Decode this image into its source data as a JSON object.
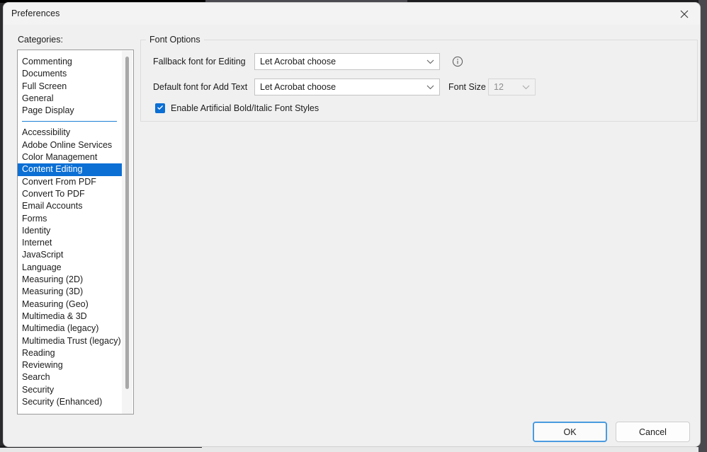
{
  "window": {
    "title": "Preferences",
    "close_icon": "close-icon"
  },
  "sidebar": {
    "label": "Categories:",
    "group_one": [
      {
        "label": "Commenting"
      },
      {
        "label": "Documents"
      },
      {
        "label": "Full Screen"
      },
      {
        "label": "General"
      },
      {
        "label": "Page Display"
      }
    ],
    "group_two": [
      {
        "label": "Accessibility",
        "selected": false
      },
      {
        "label": "Adobe Online Services",
        "selected": false
      },
      {
        "label": "Color Management",
        "selected": false
      },
      {
        "label": "Content Editing",
        "selected": true
      },
      {
        "label": "Convert From PDF",
        "selected": false
      },
      {
        "label": "Convert To PDF",
        "selected": false
      },
      {
        "label": "Email Accounts",
        "selected": false
      },
      {
        "label": "Forms",
        "selected": false
      },
      {
        "label": "Identity",
        "selected": false
      },
      {
        "label": "Internet",
        "selected": false
      },
      {
        "label": "JavaScript",
        "selected": false
      },
      {
        "label": "Language",
        "selected": false
      },
      {
        "label": "Measuring (2D)",
        "selected": false
      },
      {
        "label": "Measuring (3D)",
        "selected": false
      },
      {
        "label": "Measuring (Geo)",
        "selected": false
      },
      {
        "label": "Multimedia & 3D",
        "selected": false
      },
      {
        "label": "Multimedia (legacy)",
        "selected": false
      },
      {
        "label": "Multimedia Trust (legacy)",
        "selected": false
      },
      {
        "label": "Reading",
        "selected": false
      },
      {
        "label": "Reviewing",
        "selected": false
      },
      {
        "label": "Search",
        "selected": false
      },
      {
        "label": "Security",
        "selected": false
      },
      {
        "label": "Security (Enhanced)",
        "selected": false
      }
    ],
    "selected_category": "Content Editing"
  },
  "panel": {
    "group_title": "Font Options",
    "fallback_font": {
      "label": "Fallback font for Editing",
      "value": "Let Acrobat choose"
    },
    "default_font": {
      "label": "Default font for Add Text",
      "value": "Let Acrobat choose"
    },
    "font_size": {
      "label": "Font Size",
      "value": "12",
      "disabled": true
    },
    "info_icon": "info-icon",
    "artificial_styles": {
      "label": "Enable Artificial Bold/Italic Font Styles",
      "checked": true
    }
  },
  "footer": {
    "ok_label": "OK",
    "cancel_label": "Cancel"
  },
  "colors": {
    "accent": "#0b6fd4",
    "focus_border": "#4a9be0",
    "separator": "#1a7fd4",
    "dialog_bg": "#f0f0f0"
  }
}
